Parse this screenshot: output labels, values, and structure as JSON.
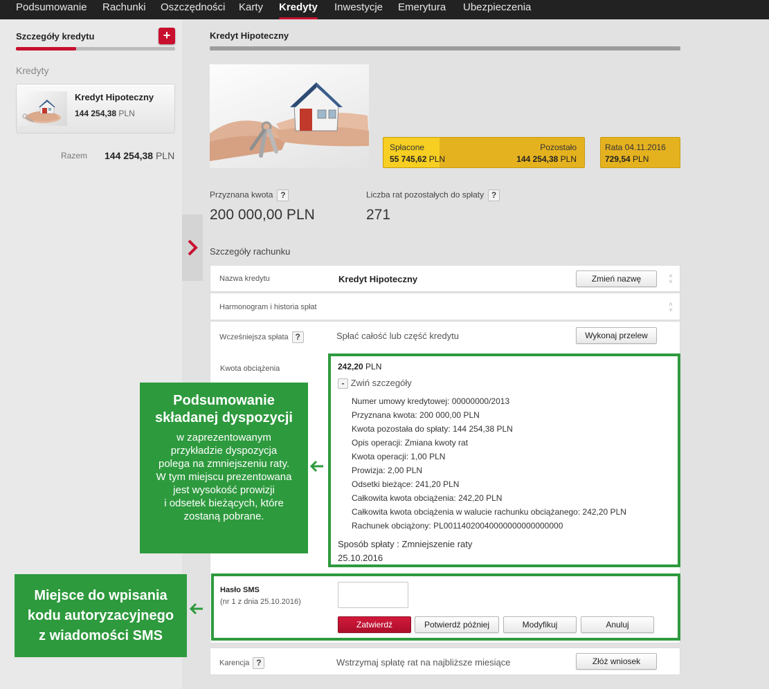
{
  "nav": {
    "items": [
      "Podsumowanie",
      "Rachunki",
      "Oszczędności",
      "Karty",
      "Kredyty",
      "Inwestycje",
      "Emerytura",
      "Ubezpieczenia"
    ],
    "active": "Kredyty"
  },
  "sidebar": {
    "title": "Szczegóły kredytu",
    "add_label": "+",
    "section": "Kredyty",
    "loan": {
      "name": "Kredyt Hipoteczny",
      "amount": "144 254,38",
      "currency": "PLN"
    },
    "total_label": "Razem",
    "total_amount": "144 254,38",
    "total_currency": "PLN"
  },
  "main": {
    "title": "Kredyt Hipoteczny",
    "summary": {
      "paid_label": "Spłacone",
      "paid_amount": "55 745,62",
      "remaining_label": "Pozostało",
      "remaining_amount": "144 254,38",
      "currency": "PLN",
      "rate_label": "Rata 04.11.2016",
      "rate_amount": "729,54",
      "paid_fraction": 0.2787
    },
    "stats": {
      "granted_label": "Przyznana kwota",
      "granted_value": "200 000,00 PLN",
      "installments_label": "Liczba rat pozostałych do spłaty",
      "installments_value": "271"
    },
    "help_label": "?",
    "details_title": "Szczegóły rachunku",
    "rows": {
      "name": {
        "label": "Nazwa kredytu",
        "value": "Kredyt Hipoteczny",
        "button": "Zmień nazwę"
      },
      "schedule": {
        "label": "Harmonogram i historia spłat"
      },
      "early": {
        "label": "Wcześniejsza spłata",
        "text": "Spłać całość lub część kredytu",
        "button": "Wykonaj przelew"
      },
      "grace": {
        "label": "Karencja",
        "text": "Wstrzymaj spłatę rat na najbliższe miesiące",
        "button": "Złóż wniosek"
      }
    },
    "charge": {
      "label": "Kwota obciążenia",
      "amount": "242,20",
      "currency": "PLN",
      "toggle_symbol": "-",
      "toggle_label": "Zwiń szczegóły",
      "details": [
        "Numer umowy kredytowej: 00000000/2013",
        "Przyznana kwota: 200 000,00 PLN",
        "Kwota pozostała do spłaty: 144 254,38 PLN",
        "Opis operacji: Zmiana kwoty rat",
        "Kwota operacji: 1,00 PLN",
        "Prowizja: 2,00 PLN",
        "Odsetki bieżące: 241,20 PLN",
        "Całkowita kwota obciążenia: 242,20 PLN",
        "Całkowita kwota obciążenia w walucie rachunku obciążanego: 242,20 PLN",
        "Rachunek obciążony: PL00114020040000000000000000"
      ],
      "method": "Sposób spłaty : Zmniejszenie raty",
      "date": "25.10.2016"
    },
    "sms": {
      "label": "Hasło SMS",
      "sublabel": "(nr 1 z dnia 25.10.2016)",
      "value": "",
      "buttons": {
        "confirm": "Zatwierdź",
        "later": "Potwierdź później",
        "modify": "Modyfikuj",
        "cancel": "Anuluj"
      }
    }
  },
  "callouts": {
    "summary": {
      "heading": [
        "Podsumowanie",
        "składanej dyspozycji"
      ],
      "body": [
        "w zaprezentowanym",
        "przykładzie dyspozycja",
        "polega na zmniejszeniu raty.",
        "W tym miejscu prezentowana",
        "jest wysokość prowizji",
        "i odsetek bieżących, które",
        "zostaną pobrane."
      ]
    },
    "sms": {
      "heading": [
        "Miejsce do wpisania",
        "kodu autoryzacyjnego",
        "z wiadomości SMS"
      ]
    }
  },
  "colors": {
    "accent": "#c8102e",
    "callout": "#2e9a3e",
    "summary_gold": "#e5b21f",
    "summary_fill": "#f6cf22",
    "nav_bg": "#222222"
  }
}
